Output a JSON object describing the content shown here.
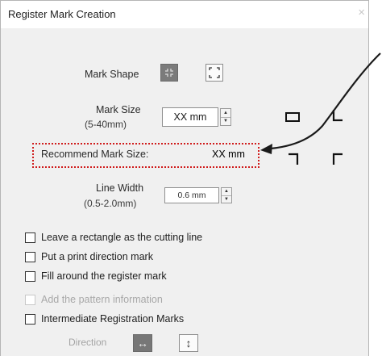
{
  "dialog": {
    "title": "Register Mark Creation",
    "close_symbol": "×"
  },
  "mark_shape": {
    "label": "Mark Shape",
    "options": [
      "inward-corners-icon",
      "outward-corners-icon"
    ],
    "selected": 0
  },
  "mark_size": {
    "label": "Mark Size",
    "range": "(5-40mm)",
    "value": "XX mm"
  },
  "recommend": {
    "label": "Recommend Mark Size:",
    "value": "XX mm"
  },
  "line_width": {
    "label": "Line Width",
    "range": "(0.5-2.0mm)",
    "value": "0.6 mm"
  },
  "options": [
    {
      "label": "Leave a rectangle as the cutting line",
      "checked": false,
      "enabled": true
    },
    {
      "label": "Put a print direction mark",
      "checked": false,
      "enabled": true
    },
    {
      "label": "Fill around the register mark",
      "checked": false,
      "enabled": true
    },
    {
      "label": "Add the pattern information",
      "checked": false,
      "enabled": false
    },
    {
      "label": "Intermediate Registration Marks",
      "checked": false,
      "enabled": true
    }
  ],
  "direction": {
    "label": "Direction",
    "options": [
      "horizontal-arrows-icon",
      "vertical-arrows-icon"
    ],
    "selected": 0
  },
  "colors": {
    "highlight": "#d01c1c",
    "selected_button": "#7b7b7b"
  }
}
